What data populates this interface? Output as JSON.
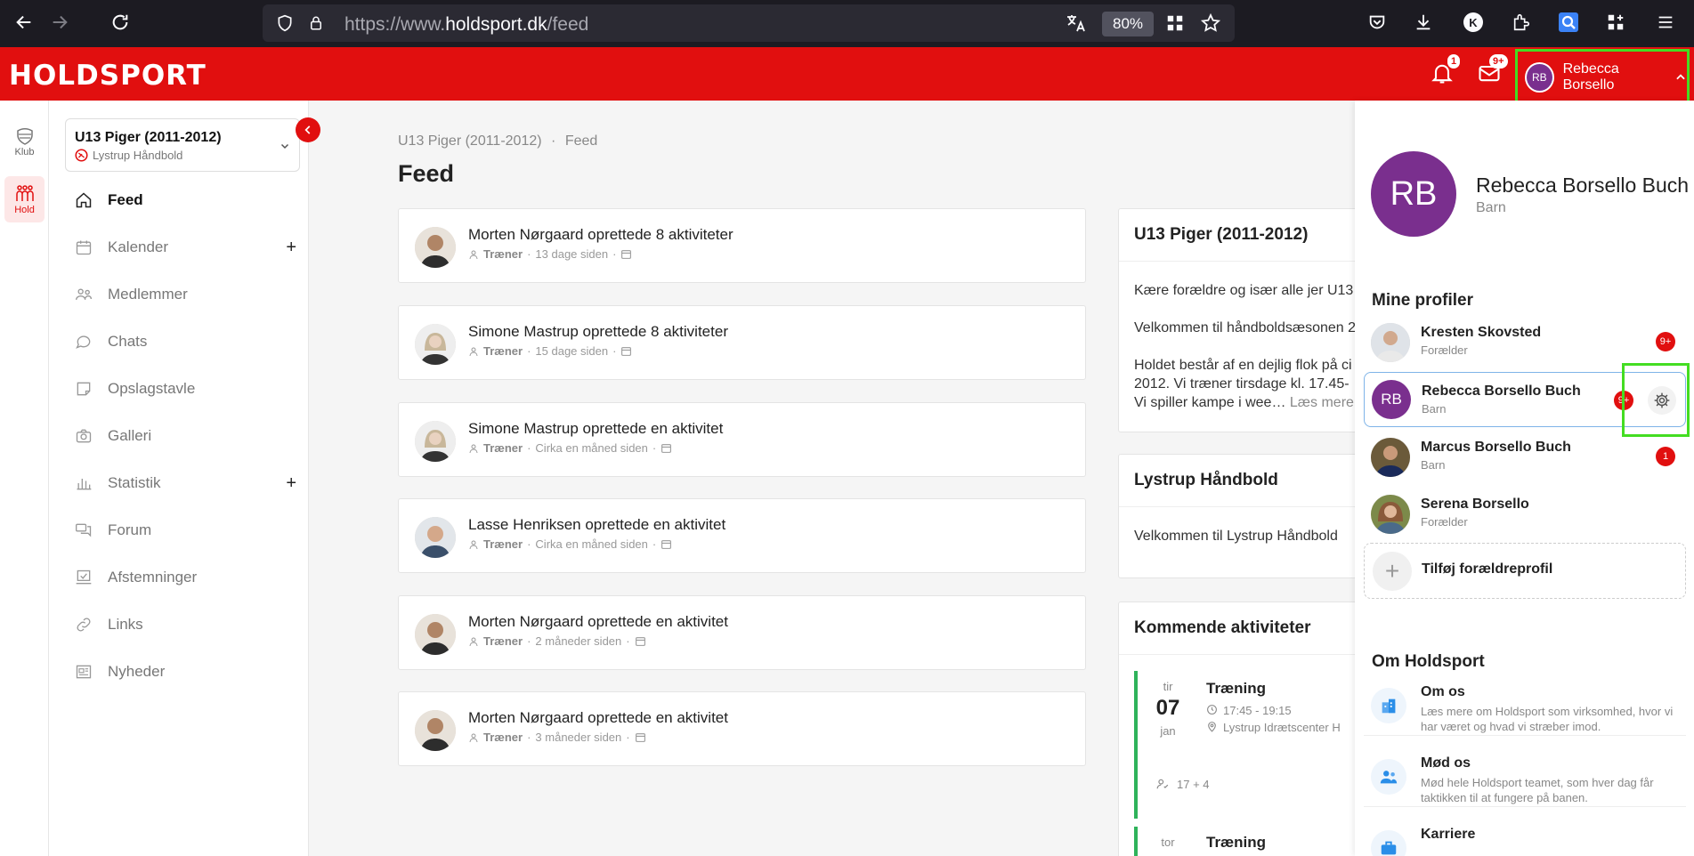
{
  "browser": {
    "url_prefix": "https://www.",
    "url_domain": "holdsport.dk",
    "url_path": "/feed",
    "zoom": "80%"
  },
  "header": {
    "logo": "HOLDSPORT",
    "notifications_badge": "1",
    "messages_badge": "9+",
    "user_initials": "RB",
    "user_name": "Rebecca Borsello",
    "accent_color": "#e10f0f"
  },
  "rail": {
    "items": [
      {
        "label": "Klub",
        "icon": "shield-icon"
      },
      {
        "label": "Hold",
        "icon": "team-icon"
      }
    ]
  },
  "sidebar": {
    "team_name": "U13 Piger (2011-2012)",
    "club_name": "Lystrup Håndbold",
    "items": [
      {
        "label": "Feed",
        "icon": "home-icon"
      },
      {
        "label": "Kalender",
        "icon": "calendar-icon"
      },
      {
        "label": "Medlemmer",
        "icon": "members-icon"
      },
      {
        "label": "Chats",
        "icon": "chat-icon"
      },
      {
        "label": "Opslagstavle",
        "icon": "notice-board-icon"
      },
      {
        "label": "Galleri",
        "icon": "camera-icon"
      },
      {
        "label": "Statistik",
        "icon": "stats-icon"
      },
      {
        "label": "Forum",
        "icon": "forum-icon"
      },
      {
        "label": "Afstemninger",
        "icon": "poll-icon"
      },
      {
        "label": "Links",
        "icon": "link-icon"
      },
      {
        "label": "Nyheder",
        "icon": "news-icon"
      }
    ]
  },
  "main": {
    "breadcrumb_team": "U13 Piger (2011-2012)",
    "breadcrumb_sep": "·",
    "breadcrumb_page": "Feed",
    "title": "Feed",
    "feed": [
      {
        "text": "Morten Nørgaard oprettede 8 aktiviteter",
        "role": "Træner",
        "time": "13 dage siden"
      },
      {
        "text": "Simone Mastrup oprettede 8 aktiviteter",
        "role": "Træner",
        "time": "15 dage siden"
      },
      {
        "text": "Simone Mastrup oprettede en aktivitet",
        "role": "Træner",
        "time": "Cirka en måned siden"
      },
      {
        "text": "Lasse Henriksen oprettede en aktivitet",
        "role": "Træner",
        "time": "Cirka en måned siden"
      },
      {
        "text": "Morten Nørgaard oprettede en aktivitet",
        "role": "Træner",
        "time": "2 måneder siden"
      },
      {
        "text": "Morten Nørgaard oprettede en aktivitet",
        "role": "Træner",
        "time": "3 måneder siden"
      }
    ]
  },
  "right": {
    "team_card_title": "U13 Piger (2011-2012)",
    "team_p1": "Kære forældre og især alle jer U13",
    "team_p2": "Velkommen til håndboldsæsonen 2",
    "team_p3a": "Holdet består af en dejlig flok på ci",
    "team_p3b": "2012. Vi træner tirsdage kl. 17.45-",
    "team_p3c": "Vi spiller kampe i wee…",
    "read_more": "Læs mere",
    "club_card_title": "Lystrup Håndbold",
    "club_text": "Velkommen til Lystrup Håndbold",
    "upcoming_title": "Kommende aktiviteter",
    "event1": {
      "dow": "tir",
      "day": "07",
      "month": "jan",
      "title": "Træning",
      "time": "17:45 - 19:15",
      "place": "Lystrup Idrætscenter H",
      "attendance": "17 + 4"
    },
    "event2": {
      "dow": "tor",
      "title": "Træning"
    }
  },
  "panel": {
    "initials": "RB",
    "name": "Rebecca Borsello Buch",
    "role": "Barn",
    "profiles_title": "Mine profiler",
    "profiles": [
      {
        "name": "Kresten Skovsted",
        "role": "Forælder",
        "badge": "9+"
      },
      {
        "name": "Rebecca Borsello Buch",
        "role": "Barn",
        "badge": "9+",
        "initials": "RB"
      },
      {
        "name": "Marcus Borsello Buch",
        "role": "Barn",
        "badge": "1"
      },
      {
        "name": "Serena Borsello",
        "role": "Forælder",
        "badge": ""
      }
    ],
    "add_profile": "Tilføj forældreprofil",
    "about_title": "Om Holdsport",
    "about": [
      {
        "title": "Om os",
        "desc": "Læs mere om Holdsport som virksomhed, hvor vi har været og hvad vi stræber imod."
      },
      {
        "title": "Mød os",
        "desc": "Mød hele Holdsport teamet, som hver dag får taktikken til at fungere på banen."
      },
      {
        "title": "Karriere",
        "desc": ""
      }
    ]
  }
}
